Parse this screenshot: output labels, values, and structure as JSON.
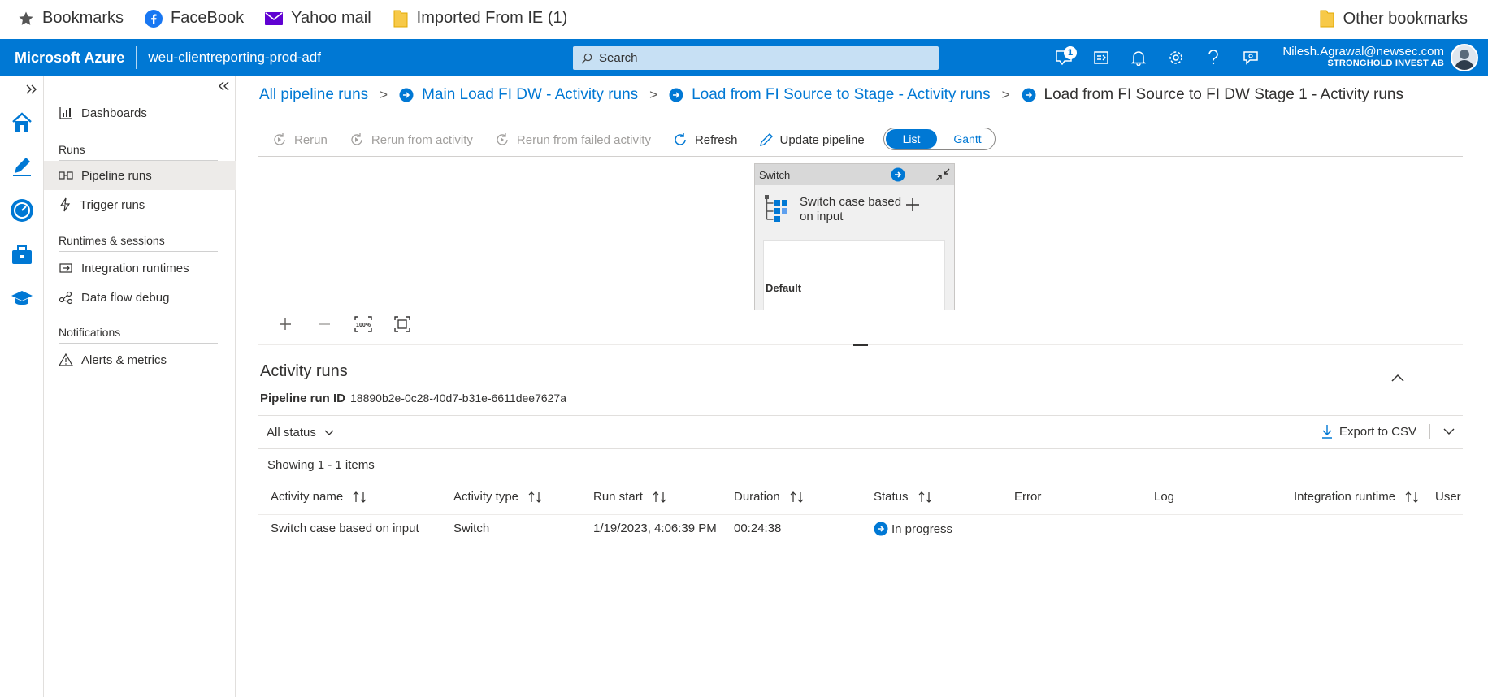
{
  "bookmarks": {
    "items": [
      {
        "label": "Bookmarks",
        "icon": "star-icon"
      },
      {
        "label": "FaceBook",
        "icon": "facebook-icon"
      },
      {
        "label": "Yahoo mail",
        "icon": "mail-icon"
      },
      {
        "label": "Imported From IE (1)",
        "icon": "folder-icon"
      }
    ],
    "other": "Other bookmarks"
  },
  "header": {
    "brand": "Microsoft Azure",
    "factory": "weu-clientreporting-prod-adf",
    "search_placeholder": "Search",
    "notification_count": "1",
    "user_name": "Nilesh.Agrawal@newsec.com",
    "user_org": "STRONGHOLD INVEST AB",
    "accent": "#0078d4"
  },
  "nav": {
    "dashboards": "Dashboards",
    "runs_section": "Runs",
    "pipeline_runs": "Pipeline runs",
    "trigger_runs": "Trigger runs",
    "runtimes_section": "Runtimes & sessions",
    "integration_runtimes": "Integration runtimes",
    "data_flow_debug": "Data flow debug",
    "notifications_section": "Notifications",
    "alerts_metrics": "Alerts & metrics"
  },
  "breadcrumb": {
    "items": [
      "All pipeline runs",
      "Main Load FI DW - Activity runs",
      "Load from FI Source to Stage - Activity runs",
      "Load from FI Source to FI DW Stage 1 - Activity runs"
    ],
    "separator": ">"
  },
  "toolbar": {
    "rerun": "Rerun",
    "rerun_from_activity": "Rerun from activity",
    "rerun_from_failed": "Rerun from failed activity",
    "refresh": "Refresh",
    "update_pipeline": "Update pipeline",
    "view_list": "List",
    "view_gantt": "Gantt"
  },
  "canvas": {
    "switch_header": "Switch",
    "switch_title_line1": "Switch case based",
    "switch_title_line2": "on input",
    "default_label": "Default"
  },
  "activity_runs": {
    "title": "Activity runs",
    "run_id_label": "Pipeline run ID",
    "run_id": "18890b2e-0c28-40d7-b31e-6611dee7627a",
    "status_filter": "All status",
    "export": "Export to CSV",
    "showing": "Showing 1 - 1 items",
    "columns": [
      "Activity name",
      "Activity type",
      "Run start",
      "Duration",
      "Status",
      "Error",
      "Log",
      "Integration runtime",
      "User"
    ],
    "rows": [
      {
        "activity_name": "Switch case based on input",
        "activity_type": "Switch",
        "run_start": "1/19/2023, 4:06:39 PM",
        "duration": "00:24:38",
        "status": "In progress"
      }
    ]
  }
}
